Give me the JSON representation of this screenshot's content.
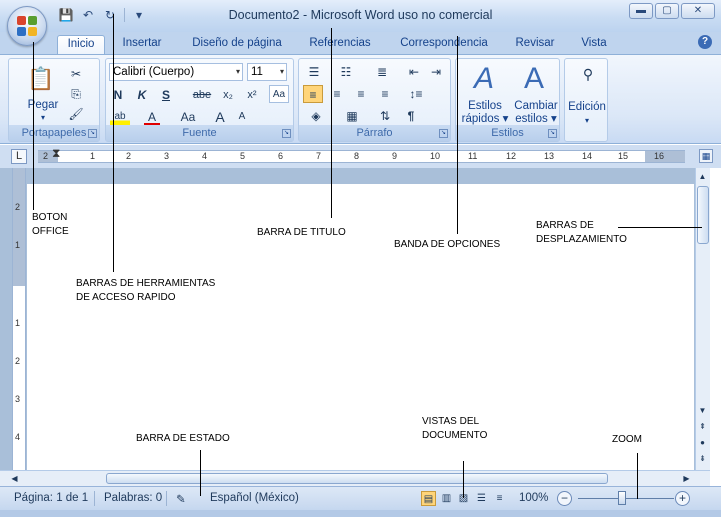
{
  "window": {
    "title": "Documento2 - Microsoft Word uso no comercial",
    "controls": [
      "minimize-icon",
      "maximize-icon",
      "close-icon"
    ]
  },
  "qat": {
    "icons": [
      "save-icon",
      "undo-icon",
      "redo-icon",
      "customize-icon"
    ]
  },
  "tabs": [
    {
      "label": "Inicio",
      "active": true
    },
    {
      "label": "Insertar"
    },
    {
      "label": "Diseño de página"
    },
    {
      "label": "Referencias"
    },
    {
      "label": "Correspondencia"
    },
    {
      "label": "Revisar"
    },
    {
      "label": "Vista"
    }
  ],
  "ribbon": {
    "portapapeles": {
      "label": "Portapapeles",
      "paste_label": "Pegar"
    },
    "fuente": {
      "label": "Fuente",
      "font_name": "Calibri (Cuerpo)",
      "font_size": "11",
      "buttons": [
        "N",
        "K",
        "S",
        "abe",
        "x₂",
        "x²",
        "A",
        "Aa",
        "A",
        "A"
      ]
    },
    "parrafo": {
      "label": "Párrafo"
    },
    "estilos": {
      "label": "Estilos",
      "quick_line1": "Estilos",
      "quick_line2": "rápidos",
      "change_line1": "Cambiar",
      "change_line2": "estilos"
    },
    "edicion": {
      "label": "Edición"
    }
  },
  "ruler": {
    "h_ticks": [
      "2",
      "1",
      "1",
      "2",
      "3",
      "4",
      "5",
      "6",
      "7",
      "8",
      "9",
      "10",
      "11",
      "12",
      "13",
      "14",
      "15",
      "16"
    ],
    "v_ticks": [
      "2",
      "1",
      "1",
      "2",
      "3",
      "4"
    ]
  },
  "status": {
    "page": "Página: 1 de 1",
    "words": "Palabras: 0",
    "language": "Español (México)",
    "zoom": "100%",
    "zoom_minus": "−",
    "zoom_plus": "+"
  },
  "annotations": {
    "boton_office_1": "BOTON",
    "boton_office_2": "OFFICE",
    "qat_1": "BARRAS DE HERRAMIENTAS",
    "qat_2": "DE ACCESO RAPIDO",
    "titulo": "BARRA DE TITULO",
    "banda": "BANDA DE OPCIONES",
    "desp_1": "BARRAS DE",
    "desp_2": "DESPLAZAMIENTO",
    "estado": "BARRA DE ESTADO",
    "vistas_1": "VISTAS DEL",
    "vistas_2": "DOCUMENTO",
    "zoom": "ZOOM"
  },
  "colors": {
    "office_red": "#d9442c",
    "office_green": "#5a9e2f",
    "office_blue": "#2d6fc4",
    "office_yellow": "#f2b424"
  }
}
